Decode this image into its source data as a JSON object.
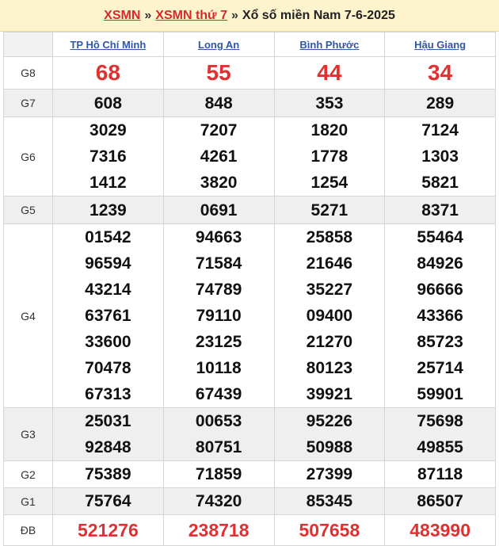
{
  "header": {
    "link1": "XSMN",
    "sep1": "»",
    "link2": "XSMN thứ 7",
    "sep2": "»",
    "title": "Xổ số miền Nam 7-6-2025"
  },
  "provinces": [
    "TP Hồ Chí Minh",
    "Long An",
    "Bình Phước",
    "Hậu Giang"
  ],
  "prizes": {
    "g8": {
      "label": "G8",
      "values": [
        [
          "68"
        ],
        [
          "55"
        ],
        [
          "44"
        ],
        [
          "34"
        ]
      ]
    },
    "g7": {
      "label": "G7",
      "values": [
        [
          "608"
        ],
        [
          "848"
        ],
        [
          "353"
        ],
        [
          "289"
        ]
      ]
    },
    "g6": {
      "label": "G6",
      "values": [
        [
          "3029",
          "7316",
          "1412"
        ],
        [
          "7207",
          "4261",
          "3820"
        ],
        [
          "1820",
          "1778",
          "1254"
        ],
        [
          "7124",
          "1303",
          "5821"
        ]
      ]
    },
    "g5": {
      "label": "G5",
      "values": [
        [
          "1239"
        ],
        [
          "0691"
        ],
        [
          "5271"
        ],
        [
          "8371"
        ]
      ]
    },
    "g4": {
      "label": "G4",
      "values": [
        [
          "01542",
          "96594",
          "43214",
          "63761",
          "33600",
          "70478",
          "67313"
        ],
        [
          "94663",
          "71584",
          "74789",
          "79110",
          "23125",
          "10118",
          "67439"
        ],
        [
          "25858",
          "21646",
          "35227",
          "09400",
          "21270",
          "80123",
          "39921"
        ],
        [
          "55464",
          "84926",
          "96666",
          "43366",
          "85723",
          "25714",
          "59901"
        ]
      ]
    },
    "g3": {
      "label": "G3",
      "values": [
        [
          "25031",
          "92848"
        ],
        [
          "00653",
          "80751"
        ],
        [
          "95226",
          "50988"
        ],
        [
          "75698",
          "49855"
        ]
      ]
    },
    "g2": {
      "label": "G2",
      "values": [
        [
          "75389"
        ],
        [
          "71859"
        ],
        [
          "27399"
        ],
        [
          "87118"
        ]
      ]
    },
    "g1": {
      "label": "G1",
      "values": [
        [
          "75764"
        ],
        [
          "74320"
        ],
        [
          "85345"
        ],
        [
          "86507"
        ]
      ]
    },
    "db": {
      "label": "ĐB",
      "values": [
        [
          "521276"
        ],
        [
          "238718"
        ],
        [
          "507658"
        ],
        [
          "483990"
        ]
      ]
    }
  },
  "colors": {
    "accent_red": "#e03131",
    "link_blue": "#2e58a6",
    "header_bg": "#fdf3cd",
    "row_shade": "#efefef"
  }
}
